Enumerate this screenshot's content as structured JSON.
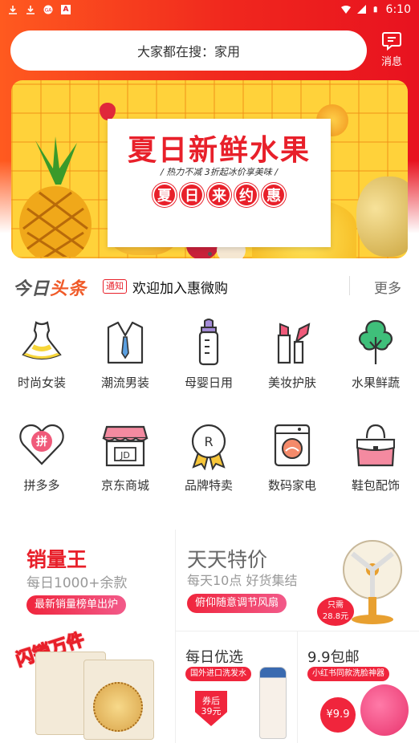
{
  "status": {
    "time": "6:10",
    "notif_badge": "A"
  },
  "search": {
    "placeholder": "大家都在搜：家用"
  },
  "message": {
    "label": "消息"
  },
  "banner": {
    "title": "夏日新鲜水果",
    "subtitle": "/ 热力不减   3折起冰价享美味 /",
    "badges": [
      "夏",
      "日",
      "来",
      "约",
      "惠"
    ]
  },
  "news": {
    "logo_a": "今日",
    "logo_b": "头条",
    "tag": "通知",
    "text": "欢迎加入惠微购",
    "more": "更多"
  },
  "categories": [
    {
      "label": "时尚女装",
      "icon": "dress-icon"
    },
    {
      "label": "潮流男装",
      "icon": "suit-icon"
    },
    {
      "label": "母婴日用",
      "icon": "baby-bottle-icon"
    },
    {
      "label": "美妆护肤",
      "icon": "cosmetics-icon"
    },
    {
      "label": "水果鲜蔬",
      "icon": "tree-icon"
    },
    {
      "label": "拼多多",
      "icon": "pinduoduo-icon",
      "glyph": "拼"
    },
    {
      "label": "京东商城",
      "icon": "jd-store-icon",
      "glyph": "JD"
    },
    {
      "label": "品牌特卖",
      "icon": "brand-medal-icon",
      "glyph": "R"
    },
    {
      "label": "数码家电",
      "icon": "washing-machine-icon"
    },
    {
      "label": "鞋包配饰",
      "icon": "handbag-icon"
    }
  ],
  "promo": {
    "best": {
      "title": "销量王",
      "sub": "每日1000+余款",
      "pill": "最新销量榜单出炉",
      "stamp": "闪销万件"
    },
    "daily": {
      "title": "天天特价",
      "sub": "每天10点 好货集结",
      "pill": "俯仰随意调节风扇",
      "price_a": "只需",
      "price_b": "28.8元"
    },
    "choice": {
      "title": "每日优选",
      "pill": "国外进口洗发水",
      "coupon_a": "券后",
      "coupon_b": "39元"
    },
    "nine": {
      "title": "9.9包邮",
      "pill": "小红书同款洗脸神器",
      "price": "¥9.9"
    }
  },
  "colors": {
    "accent": "#e8202a",
    "header_start": "#ff5a1f",
    "header_end": "#e8121f",
    "pink": "#f0253c"
  }
}
